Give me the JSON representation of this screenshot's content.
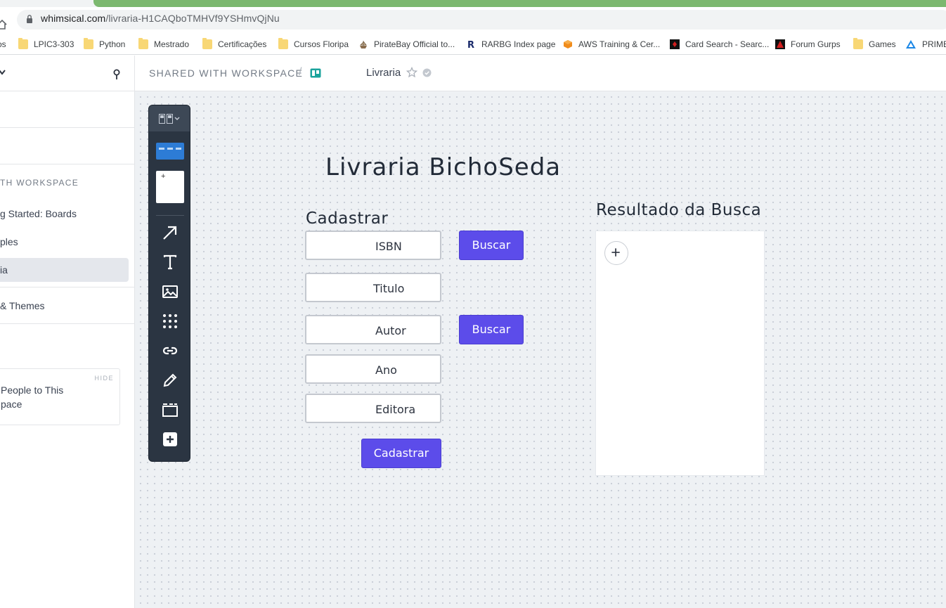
{
  "browser": {
    "url_domain": "whimsical.com",
    "url_path": "/livraria-H1CAQboTMHVf9YSHmvQjNu",
    "bookmarks": [
      {
        "label": "os",
        "icon": "folder-icon"
      },
      {
        "label": "LPIC3-303",
        "icon": "folder-icon"
      },
      {
        "label": "Python",
        "icon": "folder-icon"
      },
      {
        "label": "Mestrado",
        "icon": "folder-icon"
      },
      {
        "label": "Certificações",
        "icon": "folder-icon"
      },
      {
        "label": "Cursos Floripa",
        "icon": "folder-icon"
      },
      {
        "label": "PirateBay Official to...",
        "icon": "pirate-ship-icon"
      },
      {
        "label": "RARBG Index page",
        "icon": "rarbg-r-icon"
      },
      {
        "label": "AWS Training & Cer...",
        "icon": "aws-cube-icon"
      },
      {
        "label": "Card Search - Searc...",
        "icon": "card-search-icon"
      },
      {
        "label": "Forum Gurps",
        "icon": "gurps-icon"
      },
      {
        "label": "Games",
        "icon": "folder-icon"
      },
      {
        "label": "PRIME",
        "icon": "prime-icon"
      }
    ]
  },
  "sidebar": {
    "section_label": "TH WORKSPACE",
    "items": [
      {
        "label": "g Started: Boards",
        "active": false
      },
      {
        "label": "ples",
        "active": false
      },
      {
        "label": "ia",
        "active": true
      },
      {
        "label": "& Themes",
        "active": false
      }
    ],
    "card": {
      "hide_label": "HIDE",
      "text_line1": "People to This",
      "text_line2": "pace"
    }
  },
  "header": {
    "workspace_crumb": "SHARED WITH WORKSPACE",
    "separator": "/",
    "title": "Livraria"
  },
  "board": {
    "title": "Livraria BichoSeda",
    "form": {
      "heading": "Cadastrar",
      "fields": [
        {
          "label": "ISBN"
        },
        {
          "label": "Titulo"
        },
        {
          "label": "Autor"
        },
        {
          "label": "Ano"
        },
        {
          "label": "Editora"
        }
      ],
      "search_button_1": "Buscar",
      "search_button_2": "Buscar",
      "submit_button": "Cadastrar"
    },
    "results": {
      "heading": "Resultado da Busca",
      "add_symbol": "+"
    }
  },
  "colors": {
    "accent": "#5c4cea",
    "toolbar": "#2b3542",
    "canvas": "#eef1f4",
    "brand_green": "#7cb86f"
  }
}
